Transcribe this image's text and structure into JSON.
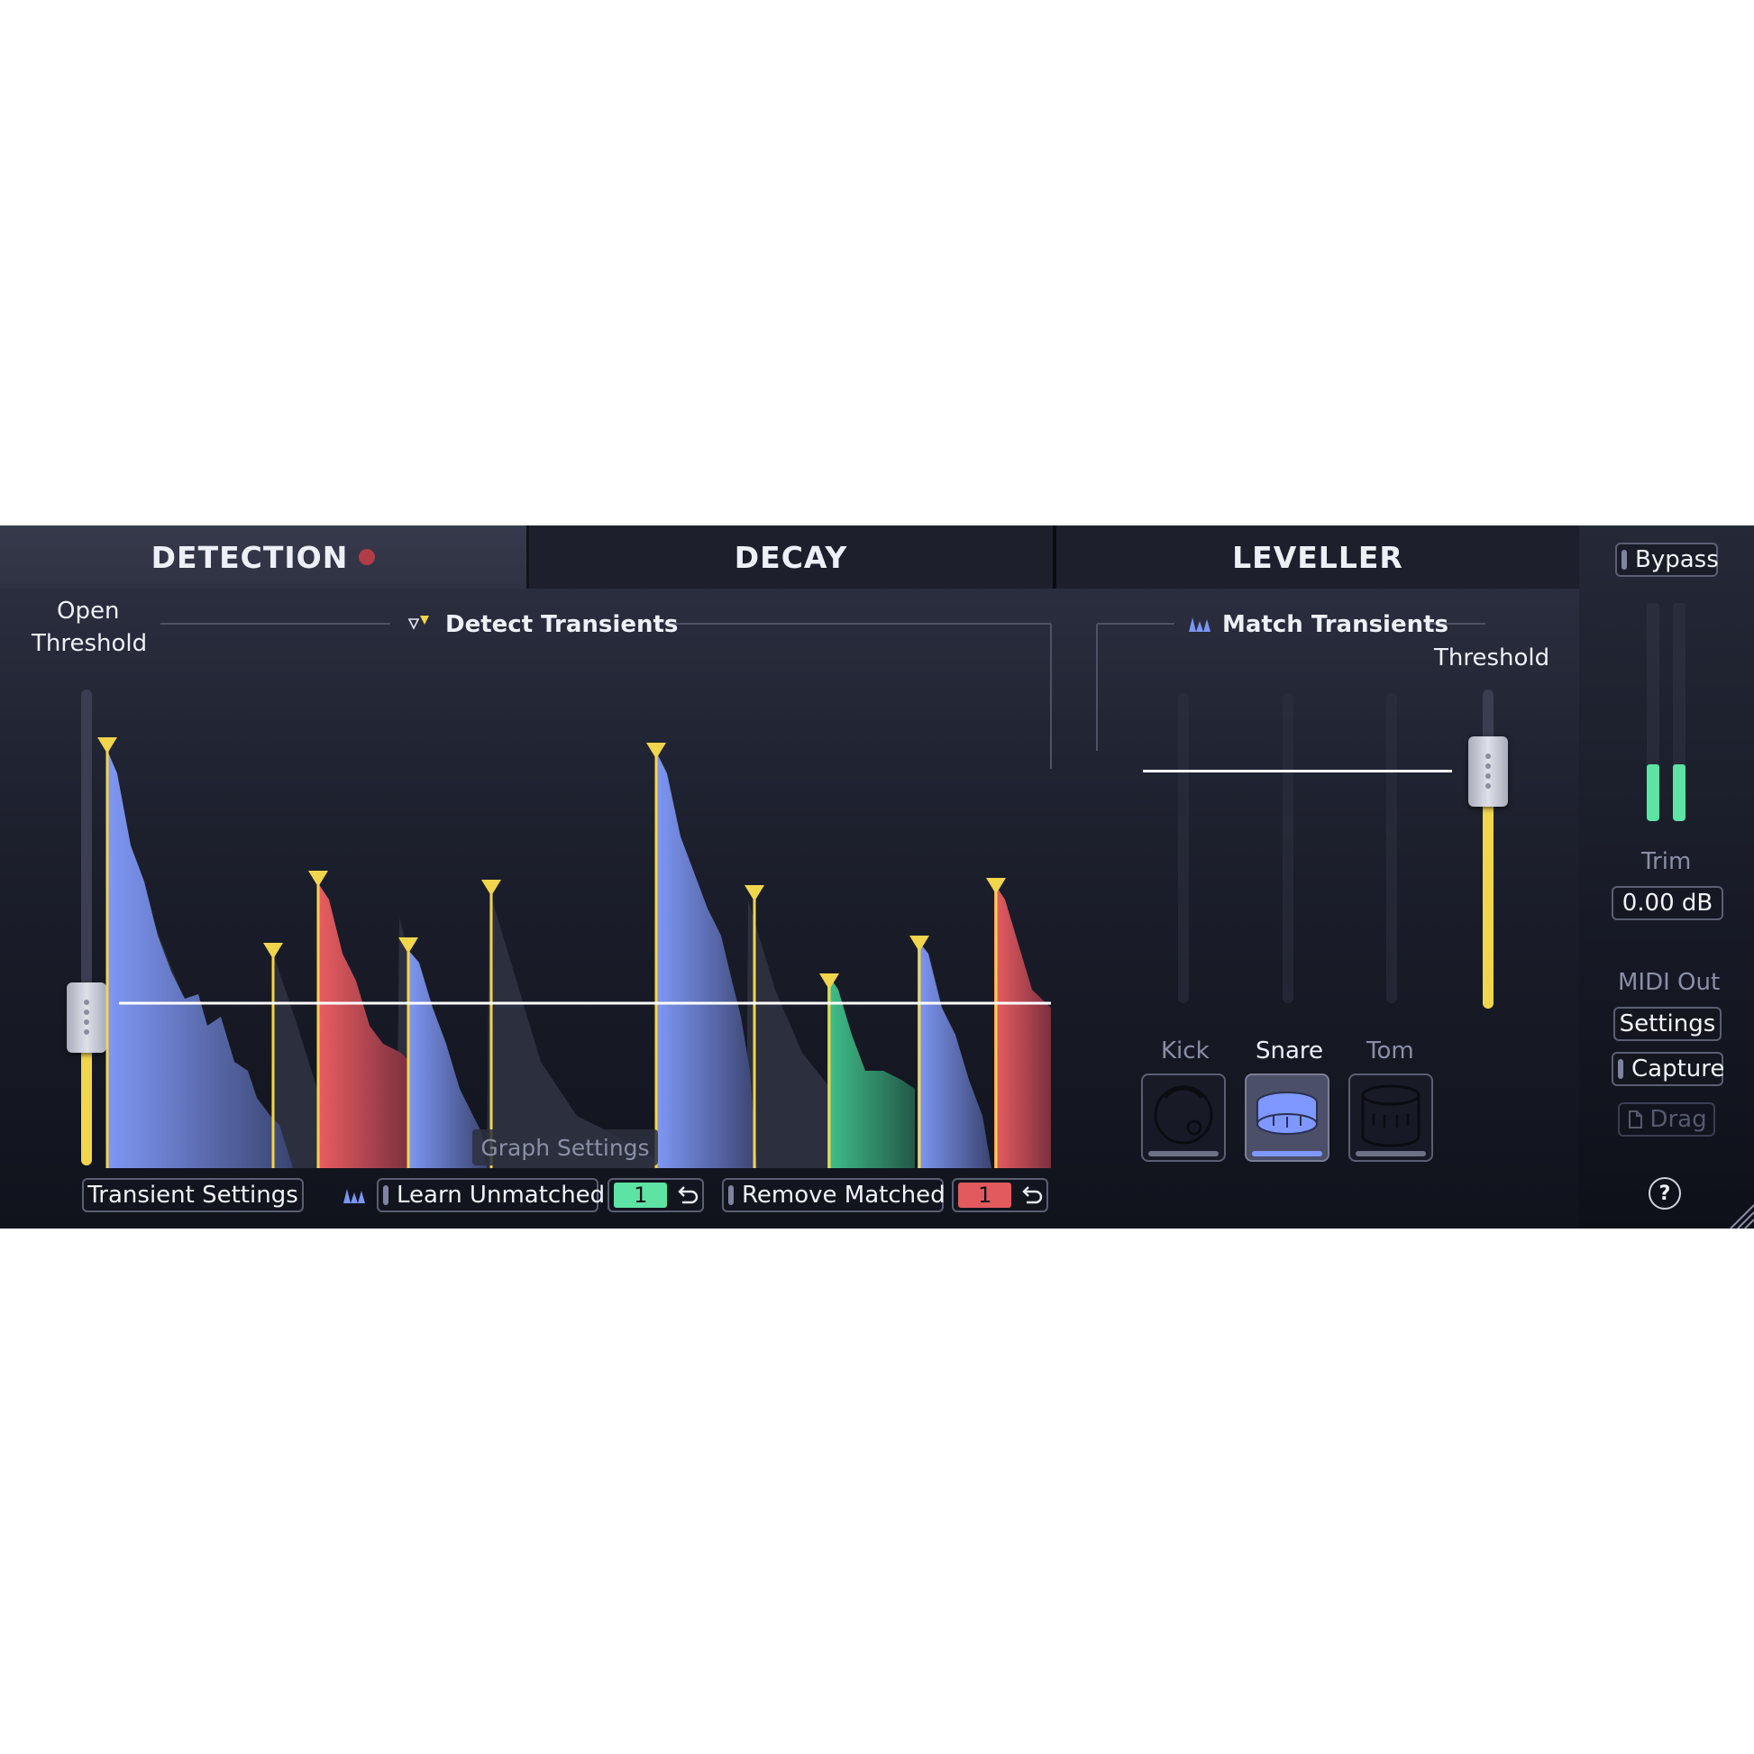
{
  "tabs": [
    {
      "label": "DETECTION"
    },
    {
      "label": "DECAY"
    },
    {
      "label": "LEVELLER"
    }
  ],
  "detection": {
    "open_threshold_label_1": "Open",
    "open_threshold_label_2": "Threshold",
    "detect_transients_label": "Detect Transients",
    "graph_settings_label": "Graph Settings",
    "transient_settings_label": "Transient Settings",
    "learn_unmatched_label": "Learn Unmatched",
    "learn_unmatched_count": "1",
    "remove_matched_label": "Remove Matched",
    "remove_matched_count": "1"
  },
  "leveller": {
    "match_transients_label": "Match Transients",
    "threshold_label": "Threshold",
    "drums": [
      {
        "label": "Kick",
        "active": false
      },
      {
        "label": "Snare",
        "active": true
      },
      {
        "label": "Tom",
        "active": false
      }
    ]
  },
  "side": {
    "bypass_label": "Bypass",
    "trim_label": "Trim",
    "trim_value": "0.00 dB",
    "midi_out_label": "MIDI Out",
    "settings_label": "Settings",
    "capture_label": "Capture",
    "drag_label": "Drag",
    "help_label": "?",
    "meter_levels": [
      0.26,
      0.26
    ]
  },
  "colors": {
    "accent_yellow": "#f1d54c",
    "transient_blue": "#7c94f2",
    "transient_red": "#e35a5e",
    "transient_green": "#3fc08a",
    "meter_green": "#5de3a3",
    "snare_active": "#7f98ff"
  }
}
